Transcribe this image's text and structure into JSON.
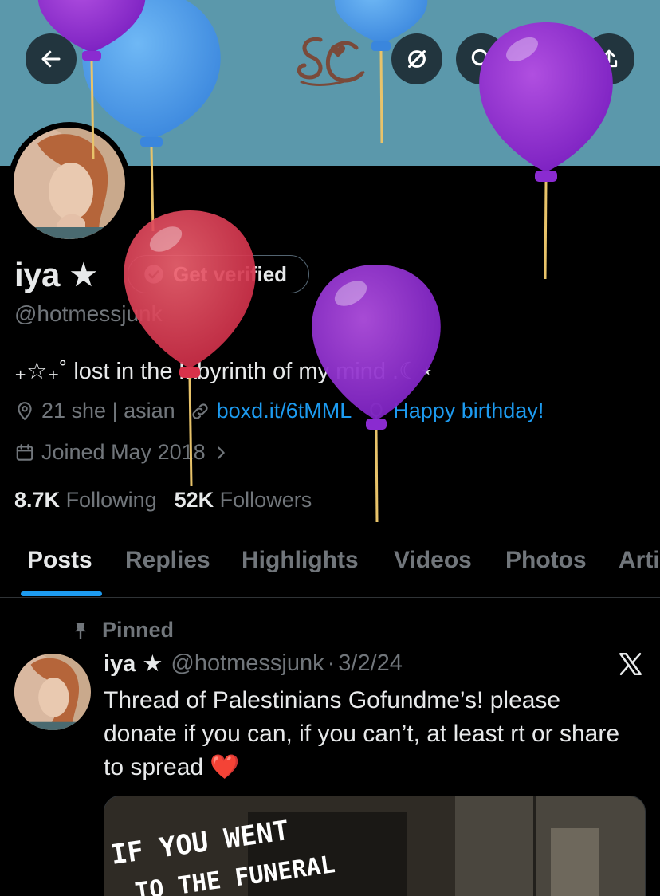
{
  "profile": {
    "name": "iya ★",
    "get_verified_label": "Get verified",
    "handle": "@hotmessjunk",
    "bio": "₊☆₊˚ lost in the labyrinth of my mind .☾⋆",
    "location": "21 she | asian",
    "website": "boxd.it/6tMML",
    "birthday": "Happy birthday!",
    "joined": "Joined May 2018",
    "following_count": "8.7K",
    "following_label": "Following",
    "followers_count": "52K",
    "followers_label": "Followers"
  },
  "tabs": [
    "Posts",
    "Replies",
    "Highlights",
    "Videos",
    "Photos",
    "Arti"
  ],
  "pinned_post": {
    "pinned_label": "Pinned",
    "name": "iya ★",
    "handle": "@hotmessjunk",
    "separator": "·",
    "date": "3/2/24",
    "text": "Thread of Palestinians Gofundme’s! please donate if you can, if you can’t, at least rt or share to spread ❤️",
    "media_caption_line1": "IF YOU WENT",
    "media_caption_line2": "TO THE FUNERAL"
  },
  "icons": {
    "back": "arrow-left-icon",
    "grok": "grok-icon",
    "search": "search-icon",
    "edit": "pencil-icon",
    "share": "share-icon",
    "verified": "verified-badge-icon",
    "location": "location-pin-icon",
    "link": "link-icon",
    "birthday": "balloon-icon",
    "calendar": "calendar-icon",
    "pin": "pin-icon",
    "x": "x-logo-icon"
  },
  "colors": {
    "accent": "#1d9bf0",
    "banner": "#5b98ab",
    "muted": "#71767b"
  }
}
